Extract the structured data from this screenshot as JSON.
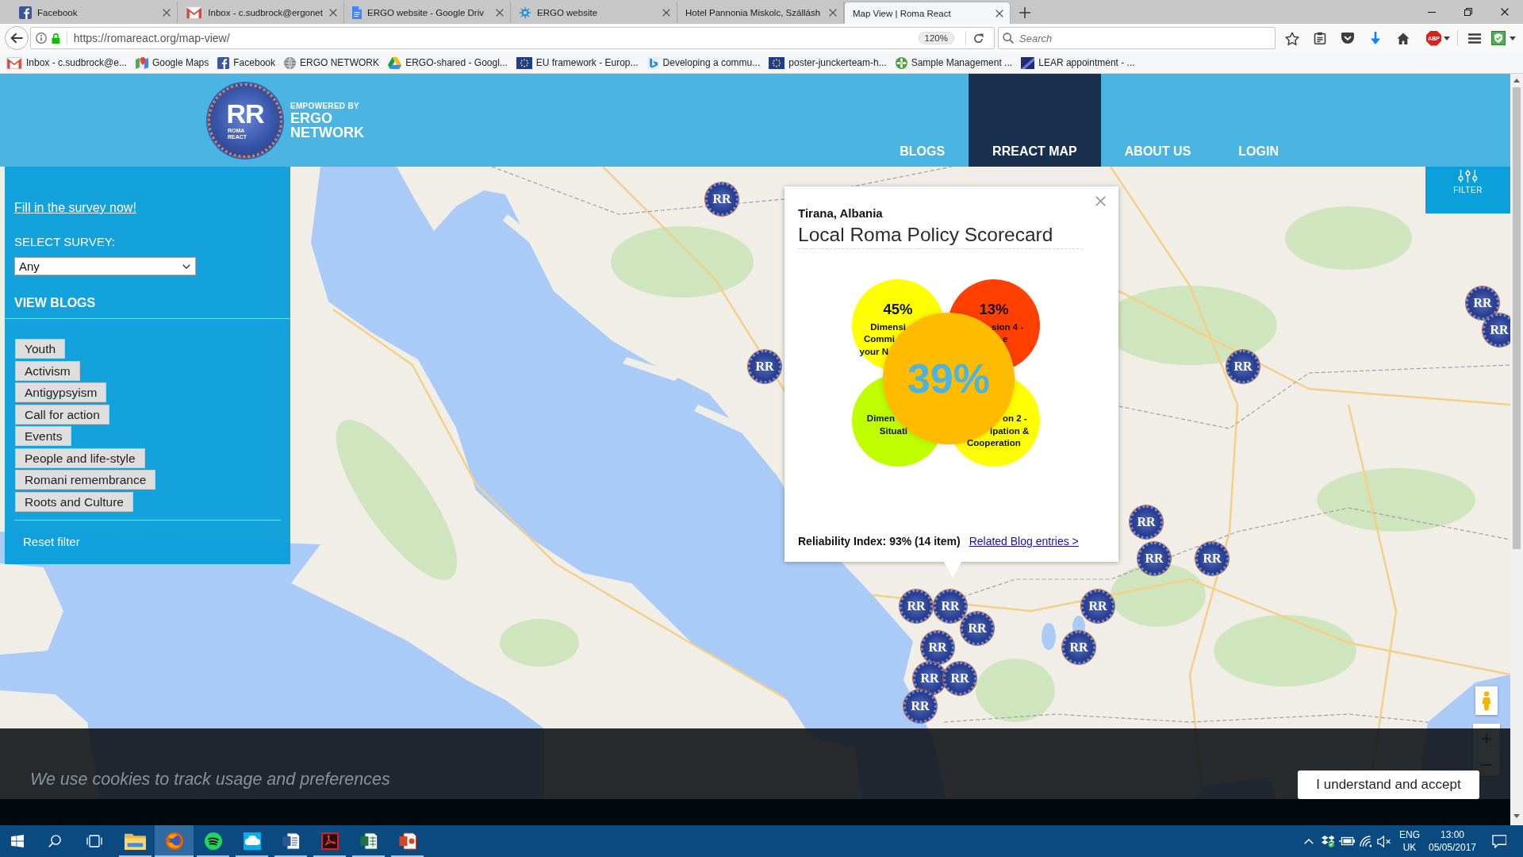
{
  "browser": {
    "tabs": [
      {
        "title": "Facebook",
        "kind": "tile",
        "selected": false
      },
      {
        "title": "Inbox - c.sudbrock@ergonet",
        "kind": "envelope",
        "selected": false
      },
      {
        "title": "ERGO website - Google Driv",
        "kind": "document",
        "selected": false
      },
      {
        "title": "ERGO website",
        "kind": "network",
        "selected": false
      },
      {
        "title": "Hotel Pannonia Miskolc, Szállásh",
        "selected": false
      },
      {
        "title": "Map View | Roma React",
        "selected": true
      }
    ],
    "address": {
      "url": "https://romareact.org/map-view/",
      "zoom": "120%"
    },
    "search": {
      "placeholder": "Search"
    },
    "extension_badge": "ABP",
    "bookmarks": [
      {
        "label": "Inbox - c.sudbrock@e...",
        "kind": "envelope"
      },
      {
        "label": "Google Maps",
        "kind": "map"
      },
      {
        "label": "Facebook",
        "kind": "tile"
      },
      {
        "label": "ERGO NETWORK",
        "kind": "globe"
      },
      {
        "label": "ERGO-shared - Googl...",
        "kind": "triangle"
      },
      {
        "label": "EU framework - Europ...",
        "kind": "flag"
      },
      {
        "label": "Developing a commu...",
        "kind": "ribbon"
      },
      {
        "label": "poster-junckerteam-h...",
        "kind": "flag"
      },
      {
        "label": "Sample Management ...",
        "kind": "flower"
      },
      {
        "label": "LEAR appointment - ...",
        "kind": "banner"
      }
    ]
  },
  "site": {
    "logo": {
      "mark": "RR",
      "subtitle": "ROMA REACT",
      "tagline": "EMPOWERED BY",
      "org": "ERGO NETWORK"
    },
    "nav": [
      {
        "label": "BLOGS",
        "selected": false
      },
      {
        "label": "RREACT MAP",
        "selected": true
      },
      {
        "label": "ABOUT US",
        "selected": false
      },
      {
        "label": "LOGIN",
        "selected": false
      }
    ]
  },
  "sidebar": {
    "survey_link": "Fill in the survey now!",
    "select_label": "SELECT SURVEY:",
    "select_value": "Any",
    "blogs_heading": "VIEW BLOGS",
    "tags": [
      "Youth",
      "Activism",
      "Antigypsyism",
      "Call for action",
      "Events",
      "People and life-style",
      "Romani remembrance",
      "Roots and Culture"
    ],
    "reset": "Reset filter"
  },
  "map": {
    "filter_button": "FILTER",
    "markers": [
      {
        "label": "RR"
      },
      {
        "label": "RR"
      },
      {
        "label": "RR"
      },
      {
        "label": "RR"
      },
      {
        "label": "RR"
      },
      {
        "label": "RR"
      },
      {
        "label": "RR"
      },
      {
        "label": "RR"
      },
      {
        "label": "RR"
      },
      {
        "label": "RR"
      },
      {
        "label": "RR"
      },
      {
        "label": "RR"
      },
      {
        "label": "RR"
      },
      {
        "label": "RR"
      },
      {
        "label": "RR"
      },
      {
        "label": "RR"
      },
      {
        "label": "RR"
      }
    ]
  },
  "popup": {
    "place": "Tirana, Albania",
    "title": "Local Roma Policy Scorecard",
    "circles": [
      {
        "value": "45%",
        "lines": [
          "Dimensi",
          "Commi",
          "your N"
        ],
        "color": "#ffff00"
      },
      {
        "value": "13%",
        "lines": [
          "sion 4 -",
          "e"
        ],
        "color": "#ff4000"
      },
      {
        "lines": [
          "Dimen",
          "Situati"
        ],
        "color": "#c0ff00"
      },
      {
        "lines": [
          "on 2 -",
          "ipation &",
          "Cooperation"
        ],
        "color": "#ffff00"
      }
    ],
    "total": {
      "value": "39%",
      "color": "#ffbb00"
    },
    "reliability": "Reliability Index: 93% (14 item)",
    "link": "Related Blog entries >"
  },
  "cookie_bar": {
    "message": "We use cookies to track usage and preferences",
    "button": "I understand and accept"
  },
  "taskbar": {
    "apps": [
      {
        "kind": "folder",
        "running": true,
        "selected": false
      },
      {
        "kind": "fox",
        "running": true,
        "selected": true
      },
      {
        "kind": "disc",
        "running": true,
        "selected": false
      },
      {
        "kind": "cloud",
        "running": true,
        "selected": false
      },
      {
        "kind": "word",
        "running": true,
        "selected": false
      },
      {
        "kind": "pdf",
        "running": true,
        "selected": false
      },
      {
        "kind": "sheet",
        "running": true,
        "selected": false
      },
      {
        "kind": "slides",
        "running": true,
        "selected": false
      }
    ],
    "tray": {
      "muted": true,
      "language": "ENG",
      "region": "UK",
      "time": "13:00",
      "date": "05/05/2017"
    }
  }
}
